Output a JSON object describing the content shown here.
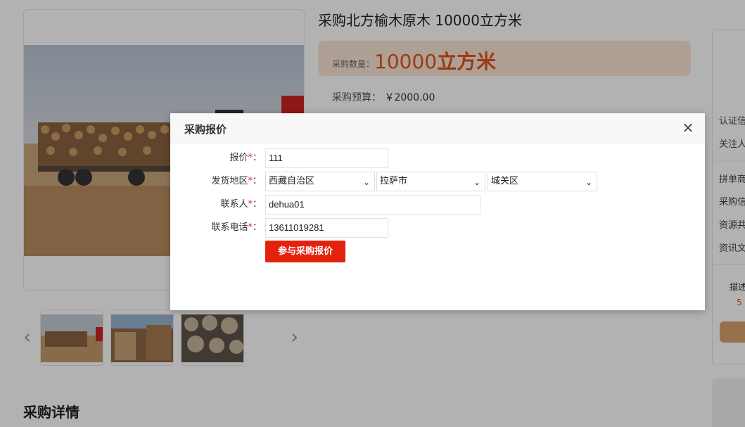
{
  "product": {
    "title": "采购北方榆木原木 10000立方米",
    "qty_label": "采购数量：",
    "qty_value": "10000",
    "qty_unit": "立方米",
    "budget_label": "采购预算：",
    "budget_value": "￥2000.00"
  },
  "gallery": {
    "prev_arrow": "‹",
    "next_arrow": "›"
  },
  "sidebar": {
    "items": [
      "认证信",
      "关注人",
      "拼单商",
      "采购信",
      "资源共",
      "资讯文"
    ],
    "desc_label": "描述",
    "score": "5"
  },
  "section": {
    "title": "采购详情"
  },
  "dialog": {
    "title": "采购报价",
    "close_icon": "×",
    "price_label": "报价",
    "price_value": "111",
    "region_label": "发货地区",
    "province": "西藏自治区",
    "city": "拉萨市",
    "district": "城关区",
    "contact_label": "联系人",
    "contact_value": "dehua01",
    "phone_label": "联系电话",
    "phone_value": "13611019281",
    "required_mark": "*",
    "colon": "：",
    "submit_label": "参与采购报价"
  },
  "colors": {
    "accent_orange": "#e0541c",
    "submit_red": "#e3210d",
    "qty_bg": "#fbe6d7"
  }
}
